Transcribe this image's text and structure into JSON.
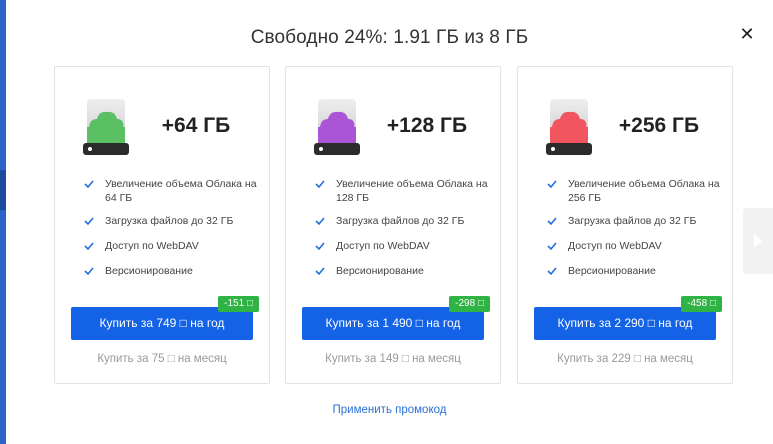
{
  "title": "Свободно 24%: 1.91 ГБ из 8 ГБ",
  "close_icon": "close-icon",
  "plans": [
    {
      "size": "+64 ГБ",
      "drive_color": "#5bc063",
      "features": [
        "Увеличение объема Облака на 64 ГБ",
        "Загрузка файлов до 32 ГБ",
        "Доступ по WebDAV",
        "Версионирование"
      ],
      "discount": "-151 □",
      "buy_label": "Купить за 749 □ на год",
      "monthly_label": "Купить за 75 □ на месяц"
    },
    {
      "size": "+128 ГБ",
      "drive_color": "#a955d6",
      "features": [
        "Увеличение объема Облака на 128 ГБ",
        "Загрузка файлов до 32 ГБ",
        "Доступ по WebDAV",
        "Версионирование"
      ],
      "discount": "-298 □",
      "buy_label": "Купить за 1 490 □ на год",
      "monthly_label": "Купить за 149 □ на месяц"
    },
    {
      "size": "+256 ГБ",
      "drive_color": "#f1555f",
      "features": [
        "Увеличение объема Облака на 256 ГБ",
        "Загрузка файлов до 32 ГБ",
        "Доступ по WebDAV",
        "Версионирование"
      ],
      "discount": "-458 □",
      "buy_label": "Купить за 2 290 □ на год",
      "monthly_label": "Купить за 229 □ на месяц"
    }
  ],
  "promo_label": "Применить промокод",
  "colors": {
    "accent": "#1462e6",
    "discount": "#2fb344",
    "check": "#1f6fe0",
    "link": "#2a6fd6"
  }
}
